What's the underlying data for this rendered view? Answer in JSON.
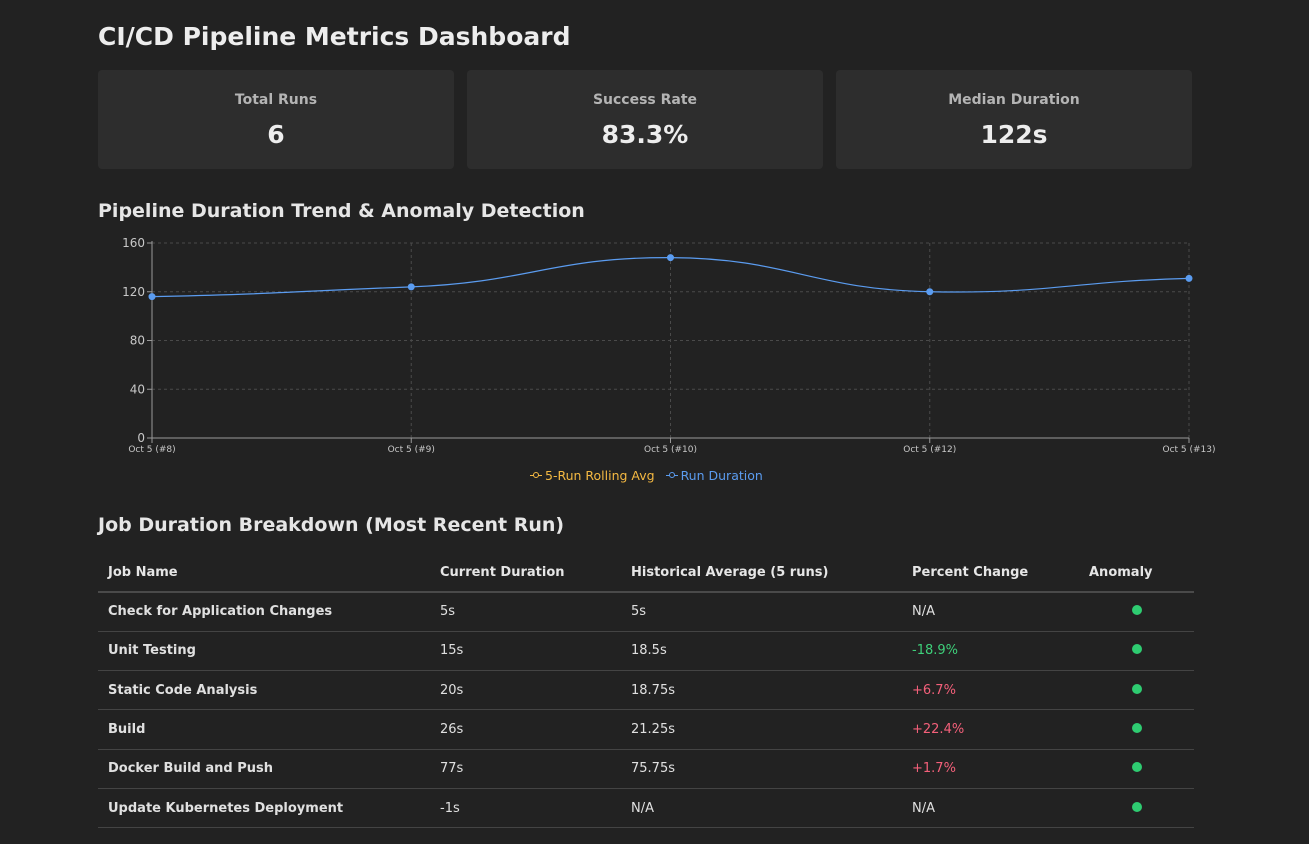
{
  "title": "CI/CD Pipeline Metrics Dashboard",
  "cards": [
    {
      "label": "Total Runs",
      "value": "6"
    },
    {
      "label": "Success Rate",
      "value": "83.3%"
    },
    {
      "label": "Median Duration",
      "value": "122s"
    }
  ],
  "chart_section_title": "Pipeline Duration Trend & Anomaly Detection",
  "chart_data": {
    "type": "line",
    "categories": [
      "Oct 5 (#8)",
      "Oct 5 (#9)",
      "Oct 5 (#10)",
      "Oct 5 (#12)",
      "Oct 5 (#13)"
    ],
    "series": [
      {
        "name": "5-Run Rolling Avg",
        "values": [],
        "color": "#f5b942"
      },
      {
        "name": "Run Duration",
        "values": [
          116,
          124,
          148,
          120,
          131
        ],
        "color": "#5b9cf0"
      }
    ],
    "yticks": [
      0,
      40,
      80,
      120,
      160
    ],
    "ylim": [
      0,
      160
    ],
    "grid": true,
    "legend": "bottom-center"
  },
  "table_section_title": "Job Duration Breakdown (Most Recent Run)",
  "table": {
    "headers": [
      "Job Name",
      "Current Duration",
      "Historical Average (5 runs)",
      "Percent Change",
      "Anomaly"
    ],
    "rows": [
      {
        "job": "Check for Application Changes",
        "current": "5s",
        "avg": "5s",
        "change": "N/A",
        "trend": "none"
      },
      {
        "job": "Unit Testing",
        "current": "15s",
        "avg": "18.5s",
        "change": "-18.9%",
        "trend": "neg"
      },
      {
        "job": "Static Code Analysis",
        "current": "20s",
        "avg": "18.75s",
        "change": "+6.7%",
        "trend": "pos"
      },
      {
        "job": "Build",
        "current": "26s",
        "avg": "21.25s",
        "change": "+22.4%",
        "trend": "pos"
      },
      {
        "job": "Docker Build and Push",
        "current": "77s",
        "avg": "75.75s",
        "change": "+1.7%",
        "trend": "pos"
      },
      {
        "job": "Update Kubernetes Deployment",
        "current": "-1s",
        "avg": "N/A",
        "change": "N/A",
        "trend": "none"
      }
    ],
    "anomaly_color": "#2ecc71"
  }
}
